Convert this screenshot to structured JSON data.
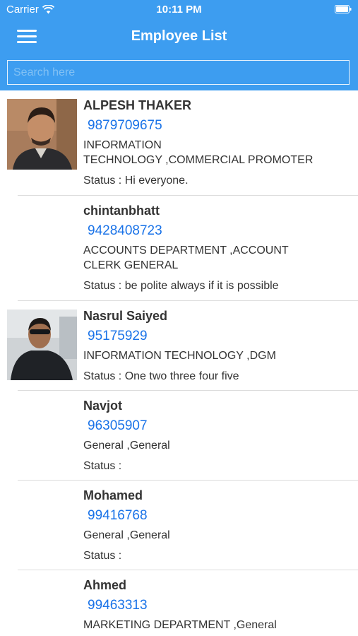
{
  "status_bar": {
    "carrier": "Carrier",
    "time": "10:11 PM",
    "wifi_icon": "wifi-icon",
    "battery_icon": "battery-icon"
  },
  "nav": {
    "title": "Employee List",
    "menu_icon": "hamburger-menu-icon"
  },
  "search": {
    "placeholder": "Search here",
    "value": ""
  },
  "colors": {
    "header_bg": "#3d9df0",
    "phone_link": "#1a73e8",
    "separator": "#dcdcdc"
  },
  "employees": [
    {
      "name": "ALPESH THAKER",
      "phone": "9879709675",
      "dept_line1": "INFORMATION",
      "dept_line2": "TECHNOLOGY ,COMMERCIAL PROMOTER",
      "status": "Status : Hi everyone.",
      "has_photo": true
    },
    {
      "name": "chintanbhatt",
      "phone": "9428408723",
      "dept_line1": "ACCOUNTS DEPARTMENT ,ACCOUNT",
      "dept_line2": "CLERK GENERAL",
      "status": "Status : be polite always if it is possible",
      "has_photo": false
    },
    {
      "name": "Nasrul Saiyed",
      "phone": "95175929",
      "dept_line1": "INFORMATION TECHNOLOGY ,DGM",
      "status": "Status : One two three four five",
      "has_photo": true
    },
    {
      "name": "Navjot",
      "phone": "96305907",
      "dept_line1": "General ,General",
      "status": "Status :",
      "has_photo": false
    },
    {
      "name": "Mohamed",
      "phone": "99416768",
      "dept_line1": "General ,General",
      "status": "Status :",
      "has_photo": false
    },
    {
      "name": "Ahmed",
      "phone": "99463313",
      "dept_line1": "MARKETING DEPARTMENT ,General",
      "status": "",
      "has_photo": false
    }
  ]
}
